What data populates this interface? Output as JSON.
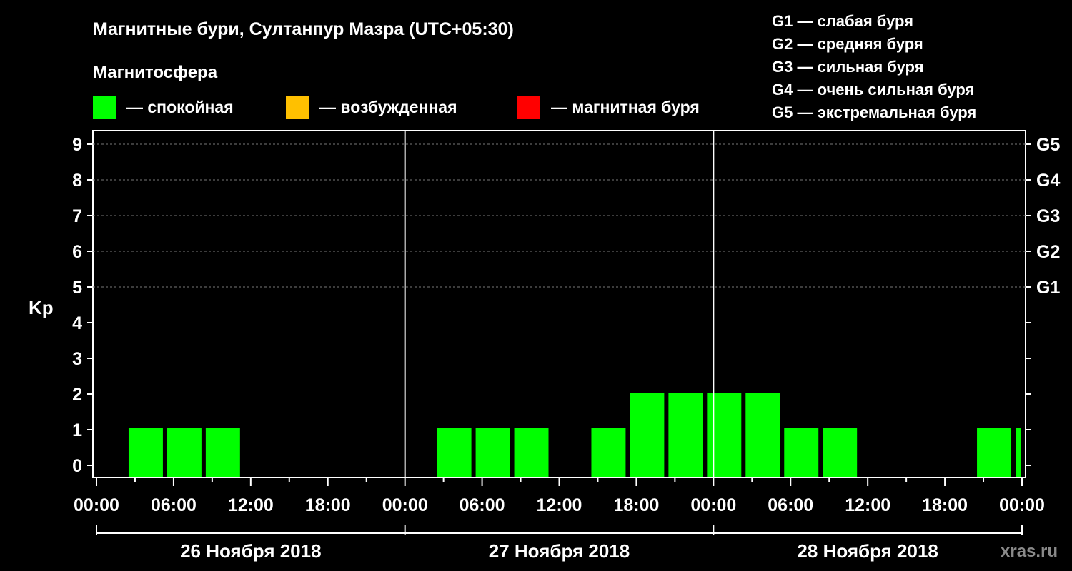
{
  "header": {
    "title": "Магнитные бури, Султанпур Мазра (UTC+05:30)",
    "subtitle": "Магнитосфера"
  },
  "legend": [
    {
      "label": "— спокойная",
      "color": "#00ff00"
    },
    {
      "label": "— возбужденная",
      "color": "#ffc000"
    },
    {
      "label": "— магнитная буря",
      "color": "#ff0000"
    }
  ],
  "g_legend": [
    "G1 — слабая буря",
    "G2 — средняя буря",
    "G3 — сильная буря",
    "G4 — очень сильная буря",
    "G5 — экстремальная буря"
  ],
  "watermark": "xras.ru",
  "chart_data": {
    "type": "bar",
    "ylabel": "Kp",
    "ylim": [
      0,
      9
    ],
    "y_ticks": [
      "0",
      "1",
      "2",
      "3",
      "4",
      "5",
      "6",
      "7",
      "8",
      "9"
    ],
    "right_ticks": [
      {
        "kp": 5,
        "label": "G1"
      },
      {
        "kp": 6,
        "label": "G2"
      },
      {
        "kp": 7,
        "label": "G3"
      },
      {
        "kp": 8,
        "label": "G4"
      },
      {
        "kp": 9,
        "label": "G5"
      }
    ],
    "gridlines_at": [
      5,
      6,
      7,
      8,
      9
    ],
    "x_tick_labels": [
      "00:00",
      "06:00",
      "12:00",
      "18:00",
      "00:00",
      "06:00",
      "12:00",
      "18:00",
      "00:00",
      "06:00",
      "12:00",
      "18:00",
      "00:00"
    ],
    "x_tick_hours": [
      0,
      6,
      12,
      18,
      24,
      30,
      36,
      42,
      48,
      54,
      60,
      66,
      72
    ],
    "x_range_hours": [
      0,
      72
    ],
    "days": [
      "26 Ноября 2018",
      "27 Ноября 2018",
      "28 Ноября 2018"
    ],
    "interval_hours": 3,
    "bars": [
      {
        "start_hour": 2.5,
        "kp": 1
      },
      {
        "start_hour": 5.5,
        "kp": 1
      },
      {
        "start_hour": 8.5,
        "kp": 1
      },
      {
        "start_hour": 26.5,
        "kp": 1
      },
      {
        "start_hour": 29.5,
        "kp": 1
      },
      {
        "start_hour": 32.5,
        "kp": 1
      },
      {
        "start_hour": 38.5,
        "kp": 1
      },
      {
        "start_hour": 41.5,
        "kp": 2
      },
      {
        "start_hour": 44.5,
        "kp": 2
      },
      {
        "start_hour": 47.5,
        "kp": 2
      },
      {
        "start_hour": 50.5,
        "kp": 2
      },
      {
        "start_hour": 53.5,
        "kp": 1
      },
      {
        "start_hour": 56.5,
        "kp": 1
      },
      {
        "start_hour": 68.5,
        "kp": 1
      },
      {
        "start_hour": 71.5,
        "kp": 1
      }
    ],
    "bar_color": "#00ff00"
  }
}
